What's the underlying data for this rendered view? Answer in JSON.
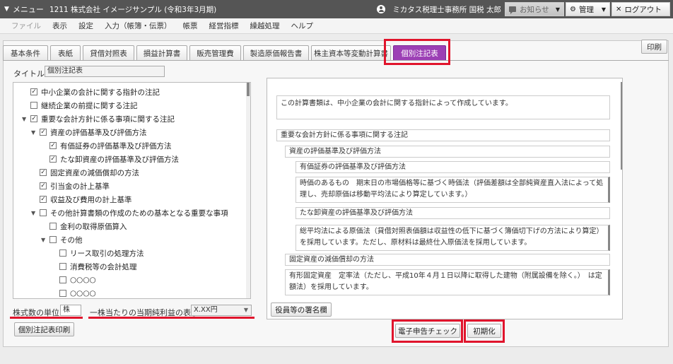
{
  "topbar": {
    "menu_label": "メニュー",
    "company": "1211 株式会社 イメージサンプル (令和3年3月期)",
    "office_user": "ミカタス税理士事務所 国税 太郎",
    "notice": "お知らせ",
    "admin": "管理",
    "logout": "ログアウト"
  },
  "menubar": [
    "ファイル",
    "表示",
    "設定",
    "入力（帳簿・伝票）",
    "帳票",
    "経営指標",
    "繰越処理",
    "ヘルプ"
  ],
  "tabs": [
    "基本条件",
    "表紙",
    "貸借対照表",
    "損益計算書",
    "販売管理費",
    "製造原価報告書",
    "株主資本等変動計算書",
    "個別注記表"
  ],
  "print_button": "印刷",
  "title": {
    "label": "タイトル",
    "value": "個別注記表"
  },
  "tree": [
    {
      "label": "中小企業の会計に関する指針の注記",
      "checked": true
    },
    {
      "label": "継続企業の前提に関する注記",
      "checked": false
    },
    {
      "label": "重要な会計方針に係る事項に関する注記",
      "checked": true
    },
    {
      "label": "資産の評価基準及び評価方法",
      "checked": true
    },
    {
      "label": "有価証券の評価基準及び評価方法",
      "checked": true
    },
    {
      "label": "たな卸資産の評価基準及び評価方法",
      "checked": true
    },
    {
      "label": "固定資産の減価償却の方法",
      "checked": true
    },
    {
      "label": "引当金の計上基準",
      "checked": true
    },
    {
      "label": "収益及び費用の計上基準",
      "checked": true
    },
    {
      "label": "その他計算書類の作成のための基本となる重要な事項",
      "checked": false
    },
    {
      "label": "金利の取得原価算入",
      "checked": false
    },
    {
      "label": "その他",
      "checked": false
    },
    {
      "label": "リース取引の処理方法",
      "checked": false
    },
    {
      "label": "消費税等の会計処理",
      "checked": false
    },
    {
      "label": "○○○○",
      "checked": false
    },
    {
      "label": "○○○○",
      "checked": false
    }
  ],
  "unit": {
    "label": "株式数の単位",
    "value": "株"
  },
  "eps": {
    "label": "一株当たりの当期純利益の表示",
    "value": "X.XX円"
  },
  "print_notes_button": "個別注記表印刷",
  "preview": {
    "intro": "この計算書類は、中小企業の会計に関する指針によって作成しています。",
    "h_policy": "重要な会計方針に係る事項に関する注記",
    "h_asset": "資産の評価基準及び評価方法",
    "h_securities": "有価証券の評価基準及び評価方法",
    "t_securities": "時価のあるもの　期末日の市場価格等に基づく時価法（評価差額は全部純資産直入法によって処理し、売却原価は移動平均法により算定しています。）",
    "h_inventory": "たな卸資産の評価基準及び評価方法",
    "t_inventory": "総平均法による原価法（貸借対照表価額は収益性の低下に基づく簿価切下げの方法により算定）を採用しています。ただし、原材料は最終仕入原価法を採用しています。",
    "h_depreciation": "固定資産の減価償却の方法",
    "t_depreciation": "有形固定資産　定率法（ただし、平成10年４月１日以降に取得した建物（附属設備を除く。）　は定額法）を採用しています。"
  },
  "signature_button": "役員等の署名欄",
  "efile_check_button": "電子申告チェック",
  "reset_button": "初期化"
}
